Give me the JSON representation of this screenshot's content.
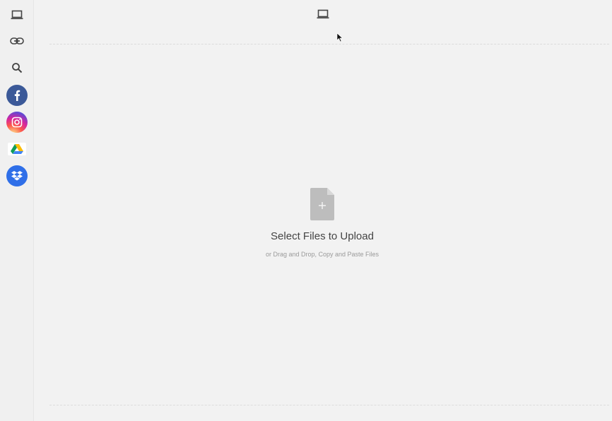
{
  "sidebar": {
    "items": [
      {
        "name": "my-device",
        "icon": "laptop-icon"
      },
      {
        "name": "link",
        "icon": "link-icon"
      },
      {
        "name": "web-search",
        "icon": "search-icon"
      },
      {
        "name": "facebook",
        "icon": "facebook-icon",
        "color": "#3b5998"
      },
      {
        "name": "instagram",
        "icon": "instagram-icon",
        "color": "#e1306c"
      },
      {
        "name": "google-drive",
        "icon": "google-drive-icon"
      },
      {
        "name": "dropbox",
        "icon": "dropbox-icon",
        "color": "#2f6fe8"
      }
    ]
  },
  "header": {
    "source_icon": "laptop-icon"
  },
  "main": {
    "upload_title": "Select Files to Upload",
    "upload_subtitle": "or Drag and Drop, Copy and Paste Files",
    "file_icon": "file-add-icon"
  },
  "colors": {
    "background": "#f2f2f2",
    "icon": "#444444",
    "file_icon": "#bdbdbd"
  }
}
